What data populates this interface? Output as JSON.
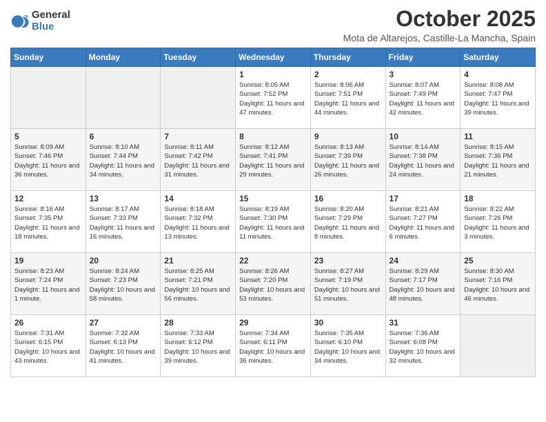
{
  "logo": {
    "general": "General",
    "blue": "Blue"
  },
  "title": "October 2025",
  "location": "Mota de Altarejos, Castille-La Mancha, Spain",
  "headers": [
    "Sunday",
    "Monday",
    "Tuesday",
    "Wednesday",
    "Thursday",
    "Friday",
    "Saturday"
  ],
  "weeks": [
    [
      {
        "day": "",
        "sunrise": "",
        "sunset": "",
        "daylight": ""
      },
      {
        "day": "",
        "sunrise": "",
        "sunset": "",
        "daylight": ""
      },
      {
        "day": "",
        "sunrise": "",
        "sunset": "",
        "daylight": ""
      },
      {
        "day": "1",
        "sunrise": "Sunrise: 8:05 AM",
        "sunset": "Sunset: 7:52 PM",
        "daylight": "Daylight: 11 hours and 47 minutes."
      },
      {
        "day": "2",
        "sunrise": "Sunrise: 8:06 AM",
        "sunset": "Sunset: 7:51 PM",
        "daylight": "Daylight: 11 hours and 44 minutes."
      },
      {
        "day": "3",
        "sunrise": "Sunrise: 8:07 AM",
        "sunset": "Sunset: 7:49 PM",
        "daylight": "Daylight: 11 hours and 42 minutes."
      },
      {
        "day": "4",
        "sunrise": "Sunrise: 8:08 AM",
        "sunset": "Sunset: 7:47 PM",
        "daylight": "Daylight: 11 hours and 39 minutes."
      }
    ],
    [
      {
        "day": "5",
        "sunrise": "Sunrise: 8:09 AM",
        "sunset": "Sunset: 7:46 PM",
        "daylight": "Daylight: 11 hours and 36 minutes."
      },
      {
        "day": "6",
        "sunrise": "Sunrise: 8:10 AM",
        "sunset": "Sunset: 7:44 PM",
        "daylight": "Daylight: 11 hours and 34 minutes."
      },
      {
        "day": "7",
        "sunrise": "Sunrise: 8:11 AM",
        "sunset": "Sunset: 7:42 PM",
        "daylight": "Daylight: 11 hours and 31 minutes."
      },
      {
        "day": "8",
        "sunrise": "Sunrise: 8:12 AM",
        "sunset": "Sunset: 7:41 PM",
        "daylight": "Daylight: 11 hours and 29 minutes."
      },
      {
        "day": "9",
        "sunrise": "Sunrise: 8:13 AM",
        "sunset": "Sunset: 7:39 PM",
        "daylight": "Daylight: 11 hours and 26 minutes."
      },
      {
        "day": "10",
        "sunrise": "Sunrise: 8:14 AM",
        "sunset": "Sunset: 7:38 PM",
        "daylight": "Daylight: 11 hours and 24 minutes."
      },
      {
        "day": "11",
        "sunrise": "Sunrise: 8:15 AM",
        "sunset": "Sunset: 7:36 PM",
        "daylight": "Daylight: 11 hours and 21 minutes."
      }
    ],
    [
      {
        "day": "12",
        "sunrise": "Sunrise: 8:16 AM",
        "sunset": "Sunset: 7:35 PM",
        "daylight": "Daylight: 11 hours and 18 minutes."
      },
      {
        "day": "13",
        "sunrise": "Sunrise: 8:17 AM",
        "sunset": "Sunset: 7:33 PM",
        "daylight": "Daylight: 11 hours and 16 minutes."
      },
      {
        "day": "14",
        "sunrise": "Sunrise: 8:18 AM",
        "sunset": "Sunset: 7:32 PM",
        "daylight": "Daylight: 11 hours and 13 minutes."
      },
      {
        "day": "15",
        "sunrise": "Sunrise: 8:19 AM",
        "sunset": "Sunset: 7:30 PM",
        "daylight": "Daylight: 11 hours and 11 minutes."
      },
      {
        "day": "16",
        "sunrise": "Sunrise: 8:20 AM",
        "sunset": "Sunset: 7:29 PM",
        "daylight": "Daylight: 11 hours and 8 minutes."
      },
      {
        "day": "17",
        "sunrise": "Sunrise: 8:21 AM",
        "sunset": "Sunset: 7:27 PM",
        "daylight": "Daylight: 11 hours and 6 minutes."
      },
      {
        "day": "18",
        "sunrise": "Sunrise: 8:22 AM",
        "sunset": "Sunset: 7:26 PM",
        "daylight": "Daylight: 11 hours and 3 minutes."
      }
    ],
    [
      {
        "day": "19",
        "sunrise": "Sunrise: 8:23 AM",
        "sunset": "Sunset: 7:24 PM",
        "daylight": "Daylight: 11 hours and 1 minute."
      },
      {
        "day": "20",
        "sunrise": "Sunrise: 8:24 AM",
        "sunset": "Sunset: 7:23 PM",
        "daylight": "Daylight: 10 hours and 58 minutes."
      },
      {
        "day": "21",
        "sunrise": "Sunrise: 8:25 AM",
        "sunset": "Sunset: 7:21 PM",
        "daylight": "Daylight: 10 hours and 56 minutes."
      },
      {
        "day": "22",
        "sunrise": "Sunrise: 8:26 AM",
        "sunset": "Sunset: 7:20 PM",
        "daylight": "Daylight: 10 hours and 53 minutes."
      },
      {
        "day": "23",
        "sunrise": "Sunrise: 8:27 AM",
        "sunset": "Sunset: 7:19 PM",
        "daylight": "Daylight: 10 hours and 51 minutes."
      },
      {
        "day": "24",
        "sunrise": "Sunrise: 8:29 AM",
        "sunset": "Sunset: 7:17 PM",
        "daylight": "Daylight: 10 hours and 48 minutes."
      },
      {
        "day": "25",
        "sunrise": "Sunrise: 8:30 AM",
        "sunset": "Sunset: 7:16 PM",
        "daylight": "Daylight: 10 hours and 46 minutes."
      }
    ],
    [
      {
        "day": "26",
        "sunrise": "Sunrise: 7:31 AM",
        "sunset": "Sunset: 6:15 PM",
        "daylight": "Daylight: 10 hours and 43 minutes."
      },
      {
        "day": "27",
        "sunrise": "Sunrise: 7:32 AM",
        "sunset": "Sunset: 6:13 PM",
        "daylight": "Daylight: 10 hours and 41 minutes."
      },
      {
        "day": "28",
        "sunrise": "Sunrise: 7:33 AM",
        "sunset": "Sunset: 6:12 PM",
        "daylight": "Daylight: 10 hours and 39 minutes."
      },
      {
        "day": "29",
        "sunrise": "Sunrise: 7:34 AM",
        "sunset": "Sunset: 6:11 PM",
        "daylight": "Daylight: 10 hours and 36 minutes."
      },
      {
        "day": "30",
        "sunrise": "Sunrise: 7:35 AM",
        "sunset": "Sunset: 6:10 PM",
        "daylight": "Daylight: 10 hours and 34 minutes."
      },
      {
        "day": "31",
        "sunrise": "Sunrise: 7:36 AM",
        "sunset": "Sunset: 6:08 PM",
        "daylight": "Daylight: 10 hours and 32 minutes."
      },
      {
        "day": "",
        "sunrise": "",
        "sunset": "",
        "daylight": ""
      }
    ]
  ]
}
